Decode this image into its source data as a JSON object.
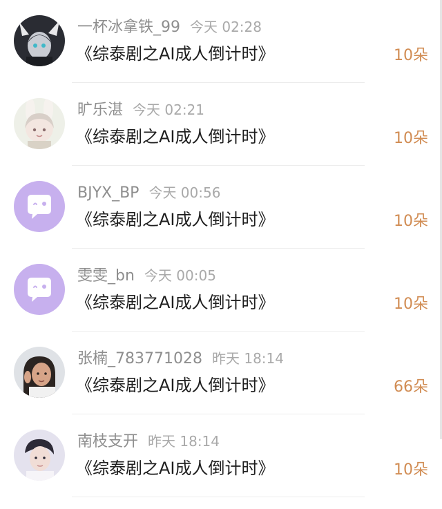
{
  "items": [
    {
      "username": "一杯冰拿铁_99",
      "time": "今天 02:28",
      "message": "《综泰剧之AI成人倒计时》",
      "amount": "10朵",
      "avatar": "dark-dragon-avatar"
    },
    {
      "username": "旷乐湛",
      "time": "今天 02:21",
      "message": "《综泰剧之AI成人倒计时》",
      "amount": "10朵",
      "avatar": "bunny-girl-avatar"
    },
    {
      "username": "BJYX_BP",
      "time": "今天 00:56",
      "message": "《综泰剧之AI成人倒计时》",
      "amount": "10朵",
      "avatar": "default-chat-avatar"
    },
    {
      "username": "雯雯_bn",
      "time": "今天 00:05",
      "message": "《综泰剧之AI成人倒计时》",
      "amount": "10朵",
      "avatar": "default-chat-avatar"
    },
    {
      "username": "张楠_783771028",
      "time": "昨天 18:14",
      "message": "《综泰剧之AI成人倒计时》",
      "amount": "66朵",
      "avatar": "girl-photo-avatar"
    },
    {
      "username": "南枝支开",
      "time": "昨天 18:14",
      "message": "《综泰剧之AI成人倒计时》",
      "amount": "10朵",
      "avatar": "boy-portrait-avatar"
    }
  ],
  "colors": {
    "username": "#8e8e8e",
    "time": "#a9a9a9",
    "message": "#1e1e1e",
    "amount": "#d18c53",
    "default_avatar_bg": "#c7b0ee"
  }
}
